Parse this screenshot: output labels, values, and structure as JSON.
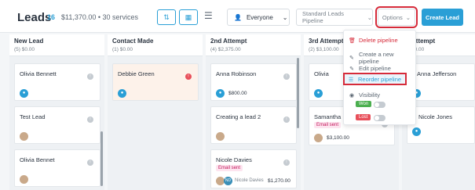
{
  "header": {
    "title": "Leads",
    "count": "16",
    "summary": "$11,370.00 • 30 services",
    "owner_filter": "Everyone",
    "pipeline": "Standard Leads Pipeline",
    "options": "Options",
    "create": "Create Lead"
  },
  "columns": [
    {
      "name": "New Lead",
      "sub": "(5) $0.00"
    },
    {
      "name": "Contact Made",
      "sub": "(1) $0.00"
    },
    {
      "name": "2nd Attempt",
      "sub": "(4) $2,375.00"
    },
    {
      "name": "3rd Attempt",
      "sub": "(2) $3,100.00"
    },
    {
      "name": "Attempt",
      "sub": "$0.00"
    }
  ],
  "cards": {
    "c1": "Olivia Bennett",
    "c2": "Test Lead",
    "c3": "Olivia Bennet",
    "c4": "Debbie Green",
    "c5": "Anna Robinson",
    "c5_amt": "$800.00",
    "c6": "Creating a lead 2",
    "c7": "Nicole Davies",
    "c7_badge": "Email sent",
    "c7_owner": "Nicole Davies",
    "c7_amt": "$1,270.00",
    "c8": "Olivia",
    "c9": "Samantha",
    "c9_badge": "Email sent",
    "c9_amt": "$3,100.00",
    "c10": "Anna Jefferson",
    "c11": "Nicole Jones",
    "initials_nd": "ND"
  },
  "menu": {
    "delete": "Delete pipeline",
    "create_new": "Create a new pipeline",
    "edit": "Edit pipeline",
    "reorder": "Reorder pipeline",
    "visibility": "Visibility",
    "won": "Won",
    "lost": "Lost"
  },
  "colors": {
    "accent": "#2a9fd6",
    "danger": "#d62b3a",
    "won": "#4caf50",
    "lost": "#e8505b"
  }
}
